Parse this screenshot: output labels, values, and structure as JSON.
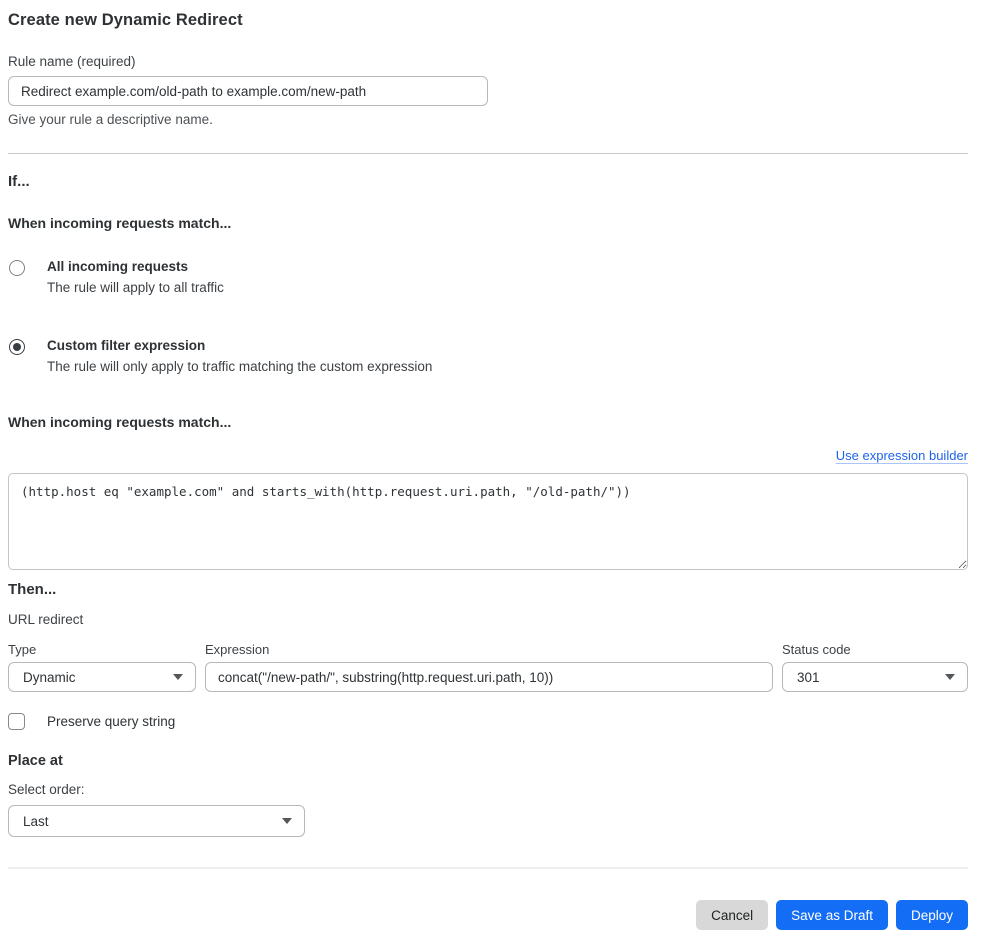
{
  "page": {
    "title": "Create new Dynamic Redirect"
  },
  "rule_name": {
    "label": "Rule name (required)",
    "value": "Redirect example.com/old-path to example.com/new-path",
    "helper": "Give your rule a descriptive name."
  },
  "if_section": {
    "heading": "If...",
    "subheading": "When incoming requests match...",
    "options": [
      {
        "label": "All incoming requests",
        "description": "The rule will apply to all traffic",
        "selected": false
      },
      {
        "label": "Custom filter expression",
        "description": "The rule will only apply to traffic matching the custom expression",
        "selected": true
      }
    ]
  },
  "expression_editor": {
    "heading": "When incoming requests match...",
    "builder_link": "Use expression builder",
    "value": "(http.host eq \"example.com\" and starts_with(http.request.uri.path, \"/old-path/\"))"
  },
  "then_section": {
    "heading": "Then...",
    "subheading": "URL redirect",
    "type_field": {
      "label": "Type",
      "value": "Dynamic"
    },
    "expression_field": {
      "label": "Expression",
      "value": "concat(\"/new-path/\", substring(http.request.uri.path, 10))"
    },
    "status_field": {
      "label": "Status code",
      "value": "301"
    },
    "preserve_query": {
      "label": "Preserve query string",
      "checked": false
    }
  },
  "place_at": {
    "heading": "Place at",
    "label": "Select order:",
    "value": "Last"
  },
  "footer": {
    "cancel_label": "Cancel",
    "save_draft_label": "Save as Draft",
    "deploy_label": "Deploy"
  },
  "colors": {
    "accent_blue": "#146ef5",
    "link_blue": "#2063e9",
    "cancel_gray": "#d8d8d8"
  }
}
